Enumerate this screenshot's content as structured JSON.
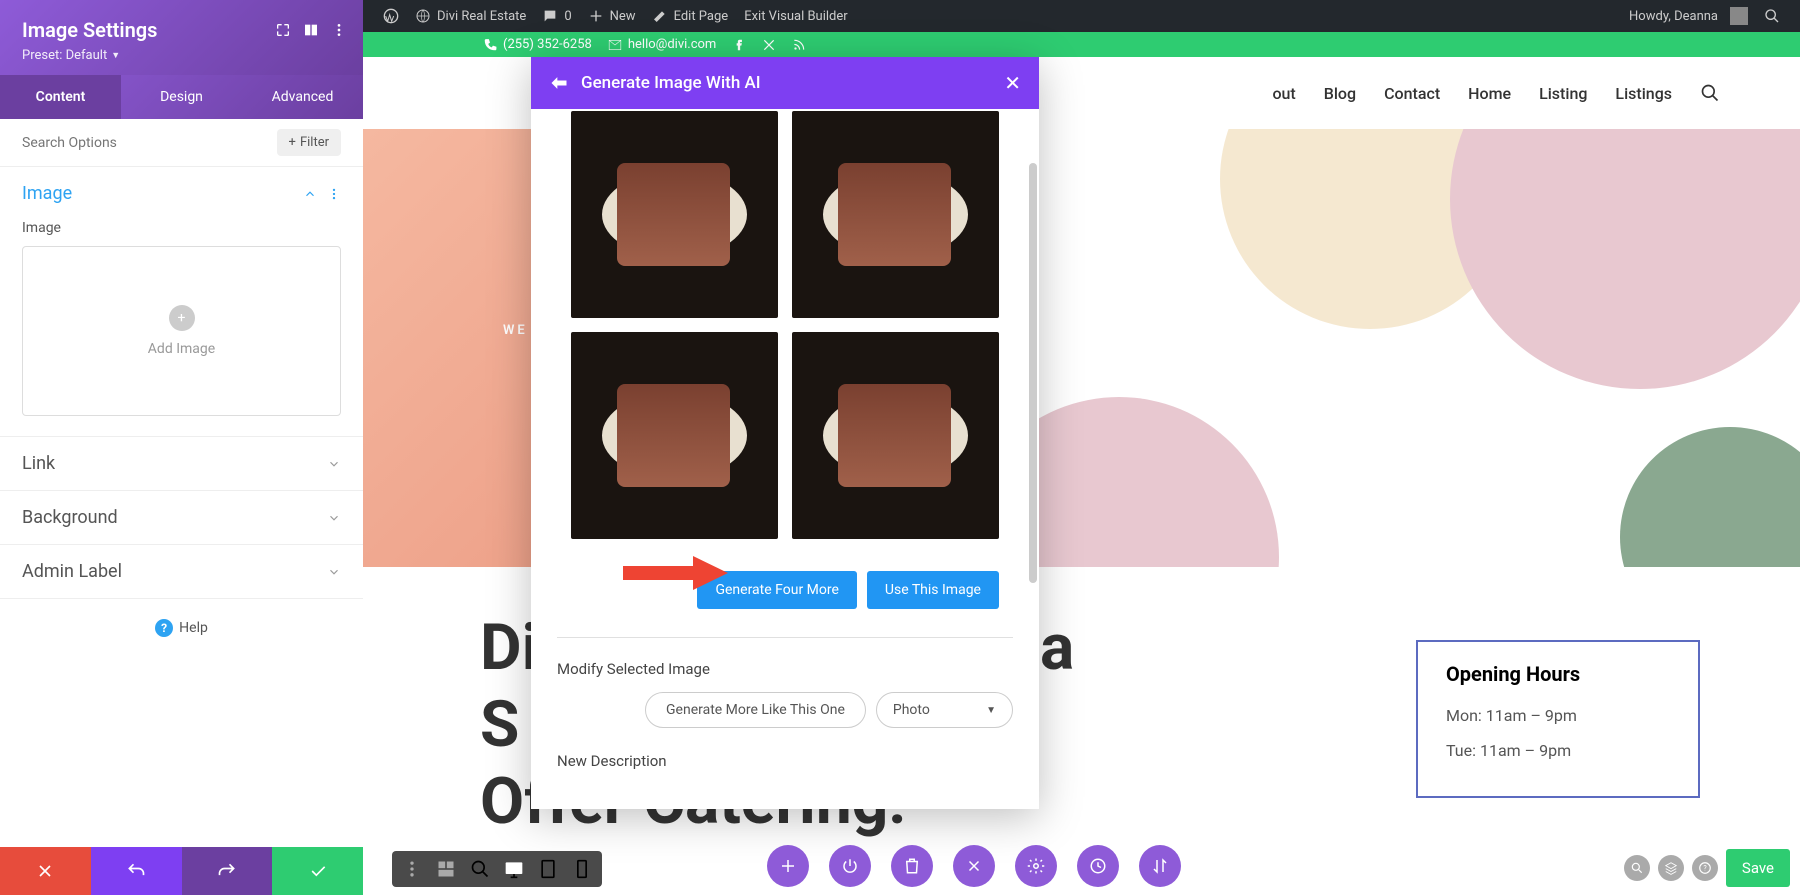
{
  "adminBar": {
    "siteName": "Divi Real Estate",
    "commentsCount": "0",
    "newLabel": "New",
    "editPage": "Edit Page",
    "exitBuilder": "Exit Visual Builder",
    "greeting": "Howdy, Deanna"
  },
  "infoBar": {
    "phone": "(255) 352-6258",
    "email": "hello@divi.com"
  },
  "nav": {
    "items": [
      "out",
      "Blog",
      "Contact",
      "Home",
      "Listing",
      "Listings"
    ]
  },
  "settings": {
    "title": "Image Settings",
    "preset": "Preset: Default",
    "tabs": {
      "content": "Content",
      "design": "Design",
      "advanced": "Advanced"
    },
    "searchPlaceholder": "Search Options",
    "filter": "Filter",
    "sections": {
      "image": "Image",
      "imageFieldLabel": "Image",
      "addImage": "Add Image",
      "link": "Link",
      "background": "Background",
      "adminLabel": "Admin Label"
    },
    "help": "Help"
  },
  "aiModal": {
    "title": "Generate Image With AI",
    "generateMore": "Generate Four More",
    "useImage": "Use This Image",
    "modifyLabel": "Modify Selected Image",
    "moreLikeThis": "Generate More Like This One",
    "styleSelected": "Photo",
    "newDescription": "New Description"
  },
  "page": {
    "heroSubtitle": "WE",
    "headline1": "Di",
    "headline2": "S",
    "headline3": "a",
    "headline4": "Offer Catering!",
    "hours": {
      "title": "Opening Hours",
      "rows": [
        "Mon: 11am – 9pm",
        "Tue: 11am – 9pm"
      ]
    }
  },
  "saveBtn": "Save"
}
